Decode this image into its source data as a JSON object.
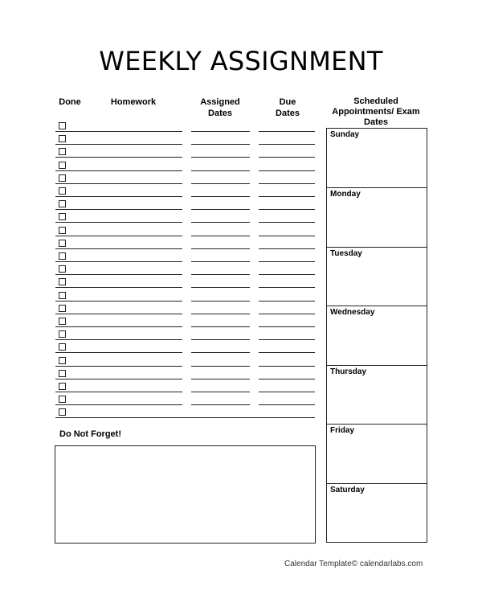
{
  "title": "WEEKLY ASSIGNMENT",
  "columns": {
    "done": "Done",
    "homework": "Homework",
    "assigned": [
      "Assigned",
      "Dates"
    ],
    "due": [
      "Due",
      "Dates"
    ],
    "scheduled": [
      "Scheduled",
      "Appointments/ Exam",
      "Dates"
    ]
  },
  "row_count": 23,
  "days": [
    "Sunday",
    "Monday",
    "Tuesday",
    "Wednesday",
    "Thursday",
    "Friday",
    "Saturday"
  ],
  "do_not_forget": "Do Not Forget!",
  "footer": "Calendar Template© calendarlabs.com"
}
